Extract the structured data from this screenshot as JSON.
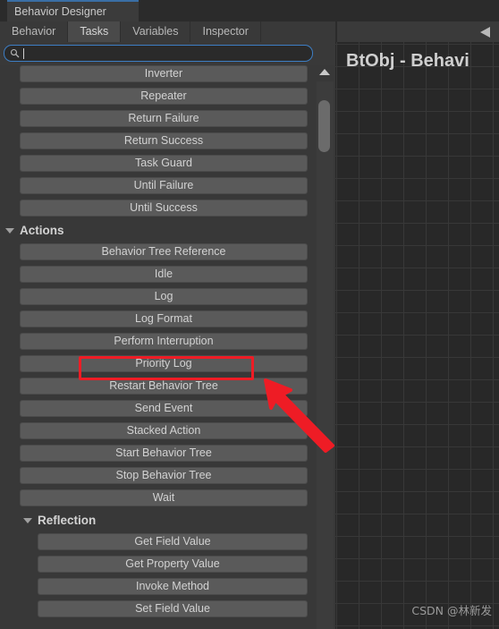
{
  "window": {
    "tab_title": "Behavior Designer",
    "accent_color": "#3a6ea5"
  },
  "subtabs": [
    {
      "label": "Behavior",
      "active": false
    },
    {
      "label": "Tasks",
      "active": true
    },
    {
      "label": "Variables",
      "active": false
    },
    {
      "label": "Inspector",
      "active": false
    }
  ],
  "search": {
    "icon": "search-icon",
    "value": "",
    "placeholder": ""
  },
  "task_list": {
    "ungrouped_items": [
      "Inverter",
      "Repeater",
      "Return Failure",
      "Return Success",
      "Task Guard",
      "Until Failure",
      "Until Success"
    ],
    "groups": [
      {
        "name": "Actions",
        "expanded": true,
        "indent": 1,
        "items": [
          "Behavior Tree Reference",
          "Idle",
          "Log",
          "Log Format",
          "Perform Interruption",
          "Priority Log",
          "Restart Behavior Tree",
          "Send Event",
          "Stacked Action",
          "Start Behavior Tree",
          "Stop Behavior Tree",
          "Wait"
        ]
      },
      {
        "name": "Reflection",
        "expanded": true,
        "indent": 2,
        "items": [
          "Get Field Value",
          "Get Property Value",
          "Invoke Method",
          "Set Field Value"
        ]
      }
    ]
  },
  "scrollbar": {
    "up_arrow_icon": "triangle-up-icon"
  },
  "graph": {
    "title": "BtObj - Behavi",
    "collapse_icon": "triangle-left-icon",
    "watermark": "CSDN @林新发"
  },
  "annotation": {
    "highlight_target": "Priority Log",
    "color": "#ee1c25"
  }
}
